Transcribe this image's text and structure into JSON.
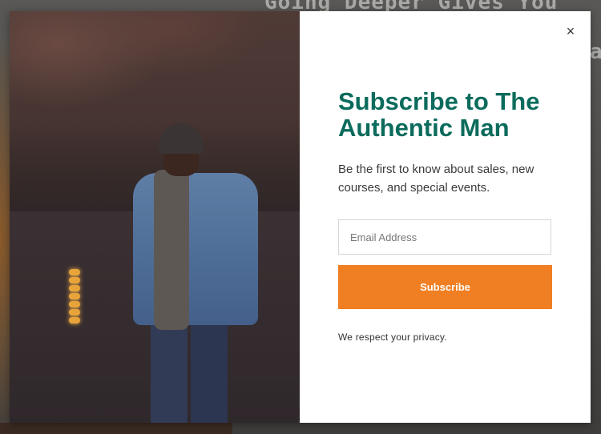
{
  "background": {
    "heading_fragment": "Going Deeper Gives You",
    "side_fragment": "ayes."
  },
  "modal": {
    "title": "Subscribe to The Authentic Man",
    "description": "Be the first to know about sales, new courses, and special events.",
    "email": {
      "placeholder": "Email Address",
      "value": ""
    },
    "subscribe_label": "Subscribe",
    "privacy_note": "We respect your privacy.",
    "close_symbol": "×",
    "colors": {
      "title": "#0b6b5c",
      "button": "#f07e22"
    }
  }
}
